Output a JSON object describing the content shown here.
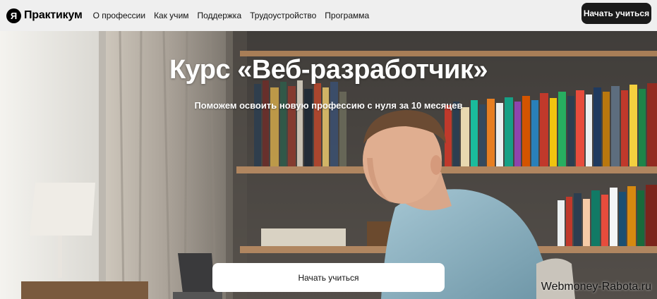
{
  "header": {
    "logo_letter": "Я",
    "logo_text": "Практикум",
    "nav": [
      {
        "label": "О профессии"
      },
      {
        "label": "Как учим"
      },
      {
        "label": "Поддержка"
      },
      {
        "label": "Трудоустройство"
      },
      {
        "label": "Программа"
      }
    ],
    "cta_label": "Начать учиться"
  },
  "hero": {
    "title": "Курс «Веб-разработчик»",
    "subtitle": "Поможем освоить новую профессию с нуля за 10 месяцев",
    "cta_label": "Начать учиться",
    "image_icon": "hero-photo-man-at-laptop"
  },
  "watermark": "Webmoney-Rabota.ru",
  "colors": {
    "header_bg": "#efefef",
    "dark_button": "#1a1a1a",
    "shirt": "#8fb6c6",
    "shelf_wood": "#a87e57"
  }
}
